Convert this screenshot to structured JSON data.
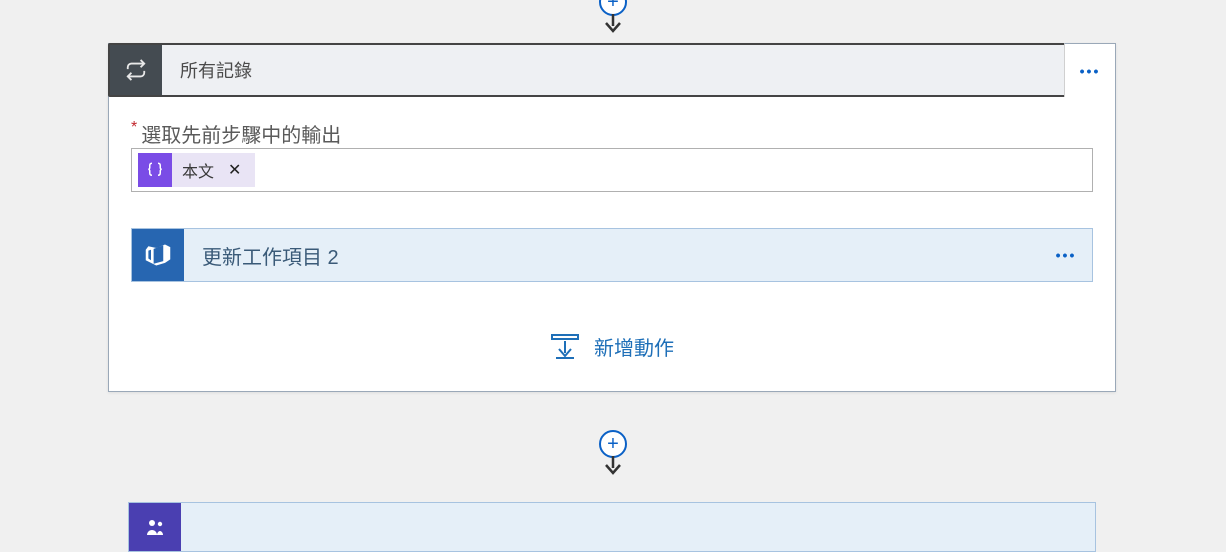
{
  "loop_step": {
    "title": "所有記錄",
    "field_label": "選取先前步驟中的輸出",
    "token": {
      "label": "本文"
    },
    "inner_action": {
      "title": "更新工作項目 2"
    },
    "add_action_label": "新增動作"
  },
  "icons": {
    "loop": "loop-arrows",
    "devops": "azure-devops",
    "insert": "insert-step",
    "token": "braces"
  }
}
